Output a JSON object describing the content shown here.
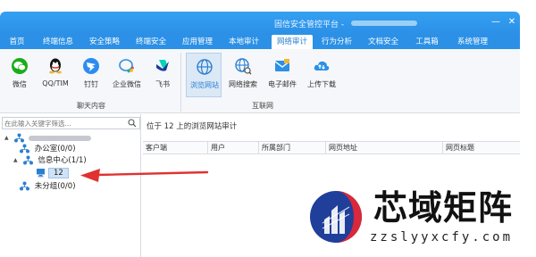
{
  "window": {
    "title": "固信安全管控平台 -",
    "controls": [
      "—",
      "✕"
    ]
  },
  "menu": {
    "items": [
      {
        "label": "首页",
        "active": false
      },
      {
        "label": "终端信息",
        "active": false
      },
      {
        "label": "安全策略",
        "active": false
      },
      {
        "label": "终端安全",
        "active": false
      },
      {
        "label": "应用管理",
        "active": false
      },
      {
        "label": "本地审计",
        "active": false
      },
      {
        "label": "网络审计",
        "active": true
      },
      {
        "label": "行为分析",
        "active": false
      },
      {
        "label": "文档安全",
        "active": false
      },
      {
        "label": "工具箱",
        "active": false
      },
      {
        "label": "系统管理",
        "active": false
      }
    ]
  },
  "ribbon": {
    "chat_group_label": "聊天内容",
    "internet_group_label": "互联网",
    "buttons": [
      {
        "label": "微信",
        "icon": "wechat-icon",
        "active": false
      },
      {
        "label": "QQ/TIM",
        "icon": "qq-icon",
        "active": false
      },
      {
        "label": "钉钉",
        "icon": "dingtalk-icon",
        "active": false
      },
      {
        "label": "企业微信",
        "icon": "wecom-icon",
        "active": false
      },
      {
        "label": "飞书",
        "icon": "feishu-icon",
        "active": false
      },
      {
        "label": "浏览网站",
        "icon": "globe-icon",
        "active": true
      },
      {
        "label": "网络搜索",
        "icon": "globe-search-icon",
        "active": false
      },
      {
        "label": "电子邮件",
        "icon": "mail-icon",
        "active": false
      },
      {
        "label": "上传下载",
        "icon": "cloud-transfer-icon",
        "active": false
      }
    ]
  },
  "left_panel": {
    "search_placeholder": "在此输入关键字筛选...",
    "tree": [
      {
        "label": "",
        "level": 0,
        "toggle": "▲",
        "icon": "org-icon",
        "selected": false
      },
      {
        "label": "办公室(0/0)",
        "level": 1,
        "toggle": "",
        "icon": "org-icon",
        "selected": false
      },
      {
        "label": "信息中心(1/1)",
        "level": 1,
        "toggle": "▲",
        "icon": "org-icon",
        "selected": false
      },
      {
        "label": "12",
        "level": 2,
        "toggle": "",
        "icon": "computer-icon",
        "selected": true
      },
      {
        "label": "未分组(0/0)",
        "level": 1,
        "toggle": "",
        "icon": "org-icon",
        "selected": false
      }
    ]
  },
  "right_panel": {
    "breadcrumb": "位于 12 上的浏览网站审计",
    "columns": [
      "客户端",
      "用户",
      "所属部门",
      "网页地址",
      "网页标题"
    ]
  },
  "watermark": {
    "brand": "芯域矩阵",
    "url": "zzslyyxcfy.com"
  },
  "colors": {
    "title_bar": "#2b90e6",
    "active_tab_text": "#2b7fd0",
    "arrow": "#e0322f"
  }
}
